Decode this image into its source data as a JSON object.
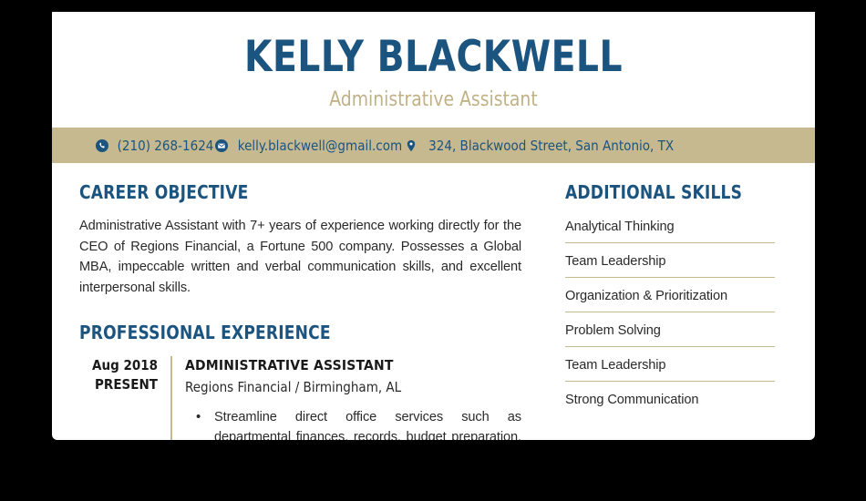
{
  "theme": {
    "accent_blue": "#1c5480",
    "accent_tan": "#c6b98f",
    "subtitle_tan": "#c0b286",
    "page_background": "#ffffff",
    "canvas_background": "#000000"
  },
  "header": {
    "full_name": "KELLY BLACKWELL",
    "job_title": "Administrative Assistant"
  },
  "contact": {
    "phone": {
      "icon": "phone-icon",
      "value": "(210) 268-1624"
    },
    "email": {
      "icon": "envelope-icon",
      "value": "kelly.blackwell@gmail.com"
    },
    "address": {
      "icon": "location-pin-icon",
      "value": "324, Blackwood Street, San Antonio, TX"
    }
  },
  "career_objective": {
    "heading": "CAREER OBJECTIVE",
    "text": "Administrative Assistant with 7+ years of experience working directly for the CEO of Regions Financial, a Fortune 500 company. Possesses a Global MBA, impeccable written and verbal communication skills, and excellent interpersonal skills."
  },
  "professional_experience": {
    "heading": "PROFESSIONAL EXPERIENCE",
    "entries": [
      {
        "date_start": "Aug 2018",
        "date_end": "PRESENT",
        "title": "ADMINISTRATIVE ASSISTANT",
        "company": "Regions Financial / Birmingham, AL",
        "bullets": [
          "Streamline direct office services such as departmental finances, records, budget preparation, personnel issues"
        ]
      }
    ]
  },
  "additional_skills": {
    "heading": "ADDITIONAL SKILLS",
    "items": [
      "Analytical Thinking",
      "Team Leadership",
      "Organization & Prioritization",
      "Problem Solving",
      "Team Leadership",
      "Strong Communication"
    ]
  }
}
